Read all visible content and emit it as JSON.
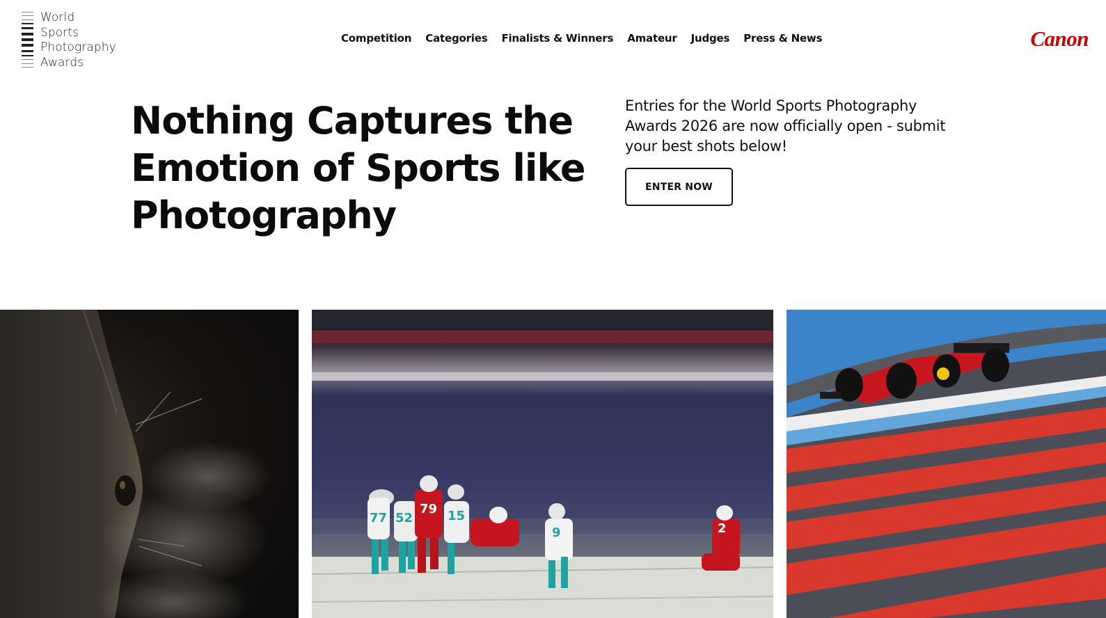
{
  "logo": {
    "lines": [
      "World",
      "Sports",
      "Photography",
      "Awards"
    ]
  },
  "nav": {
    "items": [
      "Competition",
      "Categories",
      "Finalists & Winners",
      "Amateur",
      "Judges",
      "Press & News"
    ]
  },
  "sponsor": {
    "name": "Canon",
    "color": "#cc0000"
  },
  "hero": {
    "title_lines": [
      "Nothing Captures the",
      "Emotion of Sports like",
      "Photography"
    ],
    "subtitle_lines": [
      "Entries for the World Sports Photography",
      "Awards 2026 are now officially open - submit",
      "your best shots below!"
    ],
    "cta_label": "ENTER NOW"
  },
  "gallery": {
    "photos": [
      "horse-closeup-photo",
      "american-football-snow-photo",
      "formula-one-car-photo"
    ],
    "jersey_numbers": [
      "77",
      "52",
      "79",
      "15",
      "9",
      "2"
    ]
  }
}
